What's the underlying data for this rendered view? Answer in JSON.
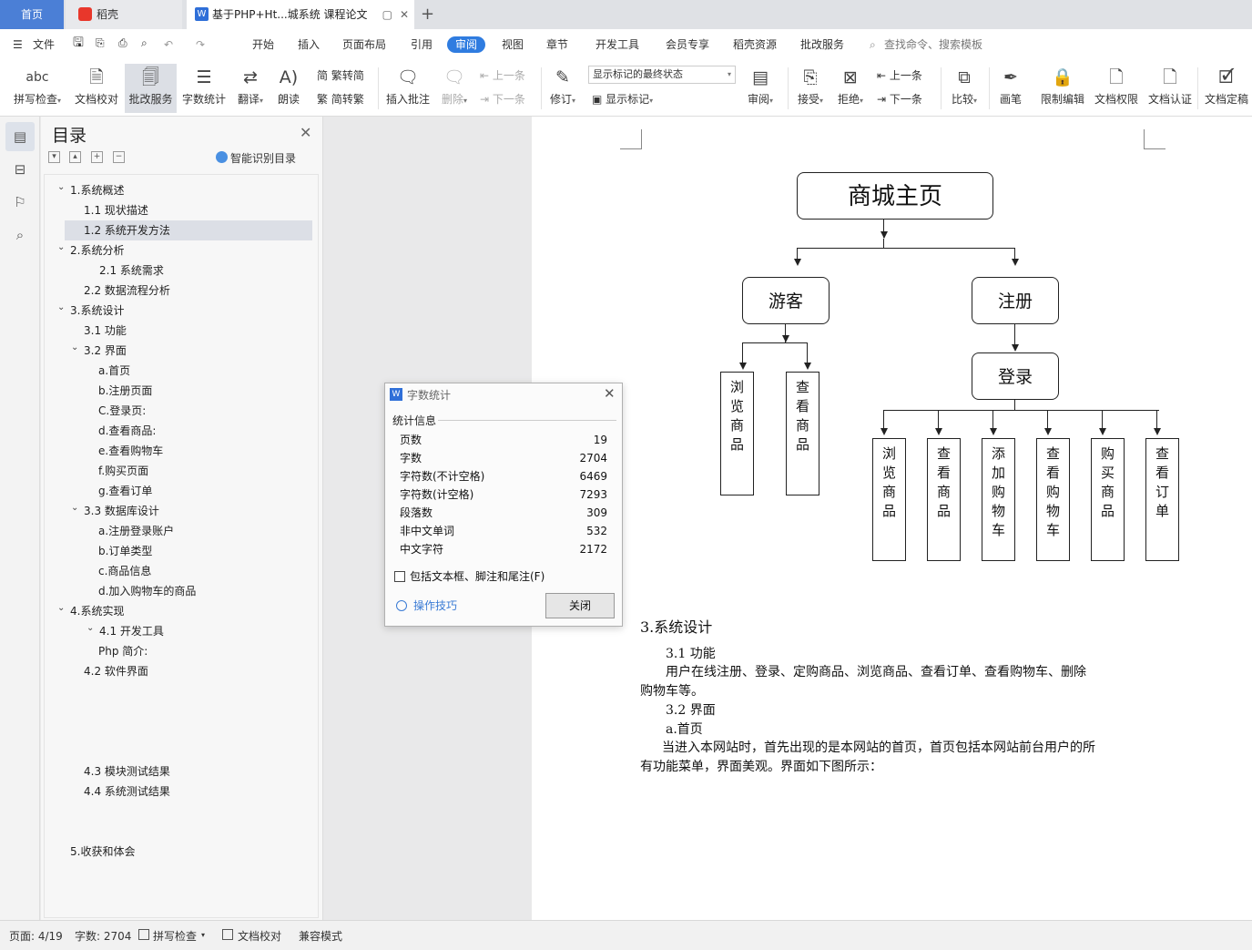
{
  "tabs": {
    "home": "首页",
    "daoke": "稻壳",
    "doc": "基于PHP+Ht...城系统 课程论文",
    "add": "+",
    "close": "✕",
    "monitor": "▢"
  },
  "menu": {
    "file": "文件",
    "items": [
      "开始",
      "插入",
      "页面布局",
      "引用",
      "审阅",
      "视图",
      "章节",
      "开发工具",
      "会员专享",
      "稻壳资源",
      "批改服务"
    ],
    "active": "审阅",
    "search": "查找命令、搜索模板"
  },
  "ribbon": {
    "spell": "拼写检查",
    "proof": "文档校对",
    "correct": "批改服务",
    "wordcount": "字数统计",
    "translate": "翻译",
    "read": "朗读",
    "trad": "繁转简",
    "simp": "简转繁",
    "insert_comment": "插入批注",
    "delete": "删除",
    "prev": "上一条",
    "next": "下一条",
    "revise": "修订",
    "markup_state": "显示标记的最终状态",
    "show_markup": "显示标记",
    "review": "审阅",
    "accept": "接受",
    "reject": "拒绝",
    "prev2": "上一条",
    "next2": "下一条",
    "compare": "比较",
    "pen": "画笔",
    "restrict": "限制编辑",
    "perm": "文档权限",
    "cert": "文档认证",
    "finalize": "文档定稿"
  },
  "toc": {
    "title": "目录",
    "smart": "智能识别目录",
    "items": [
      "1.系统概述",
      "1.1 现状描述",
      "1.2 系统开发方法",
      "2.系统分析",
      "2.1 系统需求",
      "2.2 数据流程分析",
      "3.系统设计",
      "3.1 功能",
      "3.2 界面",
      "a.首页",
      "b.注册页面",
      "C.登录页:",
      "d.查看商品:",
      "e.查看购物车",
      "f.购买页面",
      "g.查看订单",
      "3.3 数据库设计",
      "a.注册登录账户",
      "b.订单类型",
      "c.商品信息",
      "d.加入购物车的商品",
      "4.系统实现",
      "4.1 开发工具",
      "Php 简介:",
      "4.2 软件界面",
      "4.3 模块测试结果",
      "4.4 系统测试结果",
      "5.收获和体会"
    ]
  },
  "diagram": {
    "root": "商城主页",
    "guest": "游客",
    "register": "注册",
    "login": "登录",
    "guest_children": [
      "浏览商品",
      "查看商品"
    ],
    "login_children": [
      "浏览商品",
      "查看商品",
      "添加购物车",
      "查看购物车",
      "购买商品",
      "查看订单"
    ]
  },
  "doc": {
    "h3": "3.系统设计",
    "h31": "3.1 功能",
    "p1a": "用户在线注册、登录、定购商品、浏览商品、查看订单、查看购物车、删除",
    "p1b": "购物车等。",
    "h32": "3.2 界面",
    "ha": "a.首页",
    "p2a": "当进入本网站时，首先出现的是本网站的首页，首页包括本网站前台用户的所",
    "p2b": "有功能菜单，界面美观。界面如下图所示："
  },
  "dialog": {
    "title": "字数统计",
    "section": "统计信息",
    "rows": [
      {
        "k": "页数",
        "v": "19"
      },
      {
        "k": "字数",
        "v": "2704"
      },
      {
        "k": "字符数(不计空格)",
        "v": "6469"
      },
      {
        "k": "字符数(计空格)",
        "v": "7293"
      },
      {
        "k": "段落数",
        "v": "309"
      },
      {
        "k": "非中文单词",
        "v": "532"
      },
      {
        "k": "中文字符",
        "v": "2172"
      }
    ],
    "checkbox": "包括文本框、脚注和尾注(F)",
    "tips": "操作技巧",
    "close": "关闭"
  },
  "status": {
    "page": "页面: 4/19",
    "words": "字数: 2704",
    "spell": "拼写检查",
    "proof": "文档校对",
    "compat": "兼容模式"
  }
}
